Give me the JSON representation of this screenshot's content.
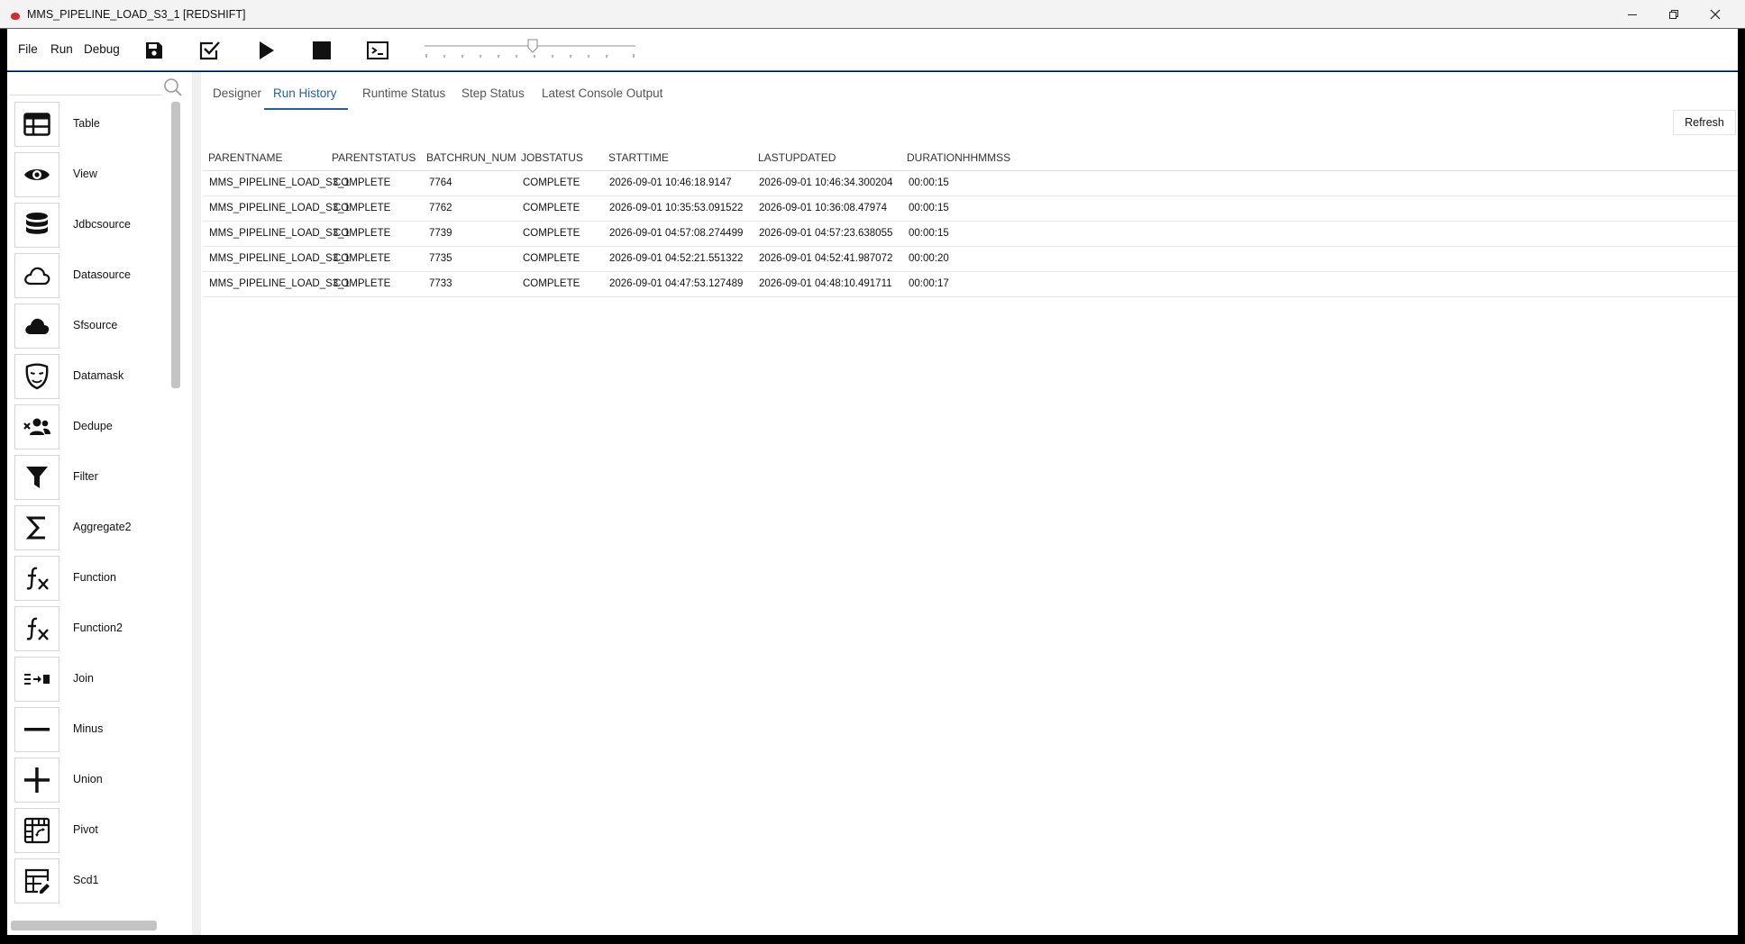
{
  "window": {
    "title": "MMS_PIPELINE_LOAD_S3_1 [REDSHIFT]"
  },
  "menu": [
    "File",
    "Run",
    "Debug"
  ],
  "toolbar": {
    "icons": [
      "save-icon",
      "validate-icon",
      "run-icon",
      "stop-icon",
      "console-icon"
    ]
  },
  "search": {
    "placeholder": ""
  },
  "palette": [
    {
      "label": "Table",
      "icon": "table-icon"
    },
    {
      "label": "View",
      "icon": "eye-icon"
    },
    {
      "label": "Jdbcsource",
      "icon": "database-icon"
    },
    {
      "label": "Datasource",
      "icon": "cloud-outline-icon"
    },
    {
      "label": "Sfsource",
      "icon": "cloud-filled-icon"
    },
    {
      "label": "Datamask",
      "icon": "mask-icon"
    },
    {
      "label": "Dedupe",
      "icon": "people-icon"
    },
    {
      "label": "Filter",
      "icon": "funnel-icon"
    },
    {
      "label": "Aggregate2",
      "icon": "sigma-icon"
    },
    {
      "label": "Function",
      "icon": "function-icon"
    },
    {
      "label": "Function2",
      "icon": "function-icon"
    },
    {
      "label": "Join",
      "icon": "join-icon"
    },
    {
      "label": "Minus",
      "icon": "minus-icon"
    },
    {
      "label": "Union",
      "icon": "plus-icon"
    },
    {
      "label": "Pivot",
      "icon": "pivot-icon"
    },
    {
      "label": "Scd1",
      "icon": "table-edit-icon"
    }
  ],
  "tabs": [
    "Designer",
    "Run History",
    "Runtime Status",
    "Step Status",
    "Latest Console Output"
  ],
  "active_tab": "Run History",
  "refresh_label": "Refresh",
  "grid": {
    "columns": [
      "PARENTNAME",
      "PARENTSTATUS",
      "BATCHRUN_NUM",
      "JOBSTATUS",
      "STARTTIME",
      "LASTUPDATED",
      "DURATIONHHMMSS"
    ],
    "rows": [
      [
        "MMS_PIPELINE_LOAD_S3_1",
        "COMPLETE",
        "7764",
        "COMPLETE",
        "2026-09-01 10:46:18.9147",
        "2026-09-01 10:46:34.300204",
        "00:00:15"
      ],
      [
        "MMS_PIPELINE_LOAD_S3_1",
        "COMPLETE",
        "7762",
        "COMPLETE",
        "2026-09-01 10:35:53.091522",
        "2026-09-01 10:36:08.47974",
        "00:00:15"
      ],
      [
        "MMS_PIPELINE_LOAD_S3_1",
        "COMPLETE",
        "7739",
        "COMPLETE",
        "2026-09-01 04:57:08.274499",
        "2026-09-01 04:57:23.638055",
        "00:00:15"
      ],
      [
        "MMS_PIPELINE_LOAD_S3_1",
        "COMPLETE",
        "7735",
        "COMPLETE",
        "2026-09-01 04:52:21.551322",
        "2026-09-01 04:52:41.987072",
        "00:00:20"
      ],
      [
        "MMS_PIPELINE_LOAD_S3_1",
        "COMPLETE",
        "7733",
        "COMPLETE",
        "2026-09-01 04:47:53.127489",
        "2026-09-01 04:48:10.491711",
        "00:00:17"
      ]
    ]
  },
  "colors": {
    "accent": "#1f5fb0",
    "app_logo": "#d42a2a"
  }
}
